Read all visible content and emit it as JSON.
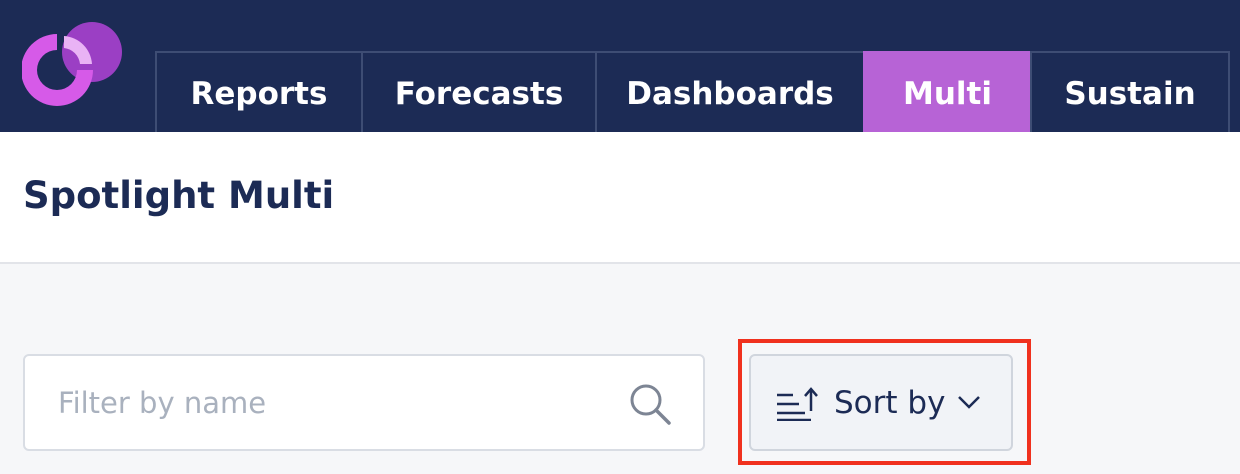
{
  "app": {
    "logo_icon": "brand-logo-icon",
    "colors": {
      "topbar_bg": "#1c2b55",
      "active_tab_bg": "#b763d6",
      "highlight_border": "#f0311e",
      "title_text": "#1c2b55"
    }
  },
  "nav": {
    "tabs": [
      {
        "label": "Reports",
        "active": false
      },
      {
        "label": "Forecasts",
        "active": false
      },
      {
        "label": "Dashboards",
        "active": false
      },
      {
        "label": "Multi",
        "active": true
      },
      {
        "label": "Sustain",
        "active": false
      }
    ]
  },
  "page": {
    "title": "Spotlight Multi"
  },
  "filter": {
    "placeholder": "Filter by name",
    "value": "",
    "icon": "search-icon"
  },
  "sort": {
    "label": "Sort by",
    "icon": "sort-ascending-icon",
    "dropdown_icon": "chevron-down-icon"
  }
}
